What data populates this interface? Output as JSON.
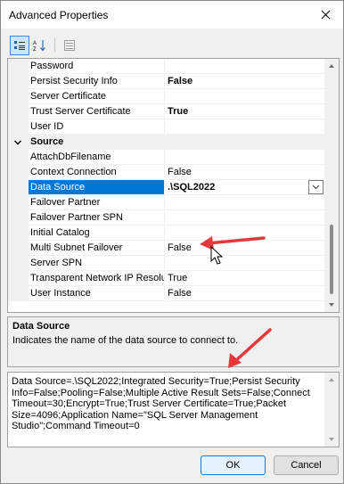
{
  "window": {
    "title": "Advanced Properties"
  },
  "toolbar": {
    "buttons": [
      {
        "name": "categorized-button",
        "icon": "categorized-icon"
      },
      {
        "name": "alphabetical-button",
        "icon": "sort-az-icon"
      },
      {
        "name": "property-pages-button",
        "icon": "property-pages-icon"
      }
    ]
  },
  "grid": {
    "rows": [
      {
        "name": "Password",
        "value": "",
        "bold": false
      },
      {
        "name": "Persist Security Info",
        "value": "False",
        "bold": true
      },
      {
        "name": "Server Certificate",
        "value": "",
        "bold": false
      },
      {
        "name": "Trust Server Certificate",
        "value": "True",
        "bold": true
      },
      {
        "name": "User ID",
        "value": "",
        "bold": false
      }
    ],
    "category": {
      "label": "Source",
      "toggle": "collapse"
    },
    "source_rows": [
      {
        "name": "AttachDbFilename",
        "value": "",
        "bold": false
      },
      {
        "name": "Context Connection",
        "value": "False",
        "bold": false
      },
      {
        "name": "Data Source",
        "value": ".\\SQL2022",
        "bold": true,
        "selected": true
      },
      {
        "name": "Failover Partner",
        "value": "",
        "bold": false
      },
      {
        "name": "Failover Partner SPN",
        "value": "",
        "bold": false
      },
      {
        "name": "Initial Catalog",
        "value": "",
        "bold": false
      },
      {
        "name": "Multi Subnet Failover",
        "value": "False",
        "bold": false
      },
      {
        "name": "Server SPN",
        "value": "",
        "bold": false
      },
      {
        "name": "Transparent Network IP Resolu",
        "value": "True",
        "bold": false
      },
      {
        "name": "User Instance",
        "value": "False",
        "bold": false
      }
    ]
  },
  "help": {
    "title": "Data Source",
    "description": "Indicates the name of the data source to connect to."
  },
  "connection_string": "Data Source=.\\SQL2022;Integrated Security=True;Persist Security Info=False;Pooling=False;Multiple Active Result Sets=False;Connect Timeout=30;Encrypt=True;Trust Server Certificate=True;Packet Size=4096;Application Name=\"SQL Server Management Studio\";Command Timeout=0",
  "buttons": {
    "ok": "OK",
    "cancel": "Cancel"
  },
  "colors": {
    "selection": "#0078d7",
    "annotation_arrow": "#e5383b"
  }
}
